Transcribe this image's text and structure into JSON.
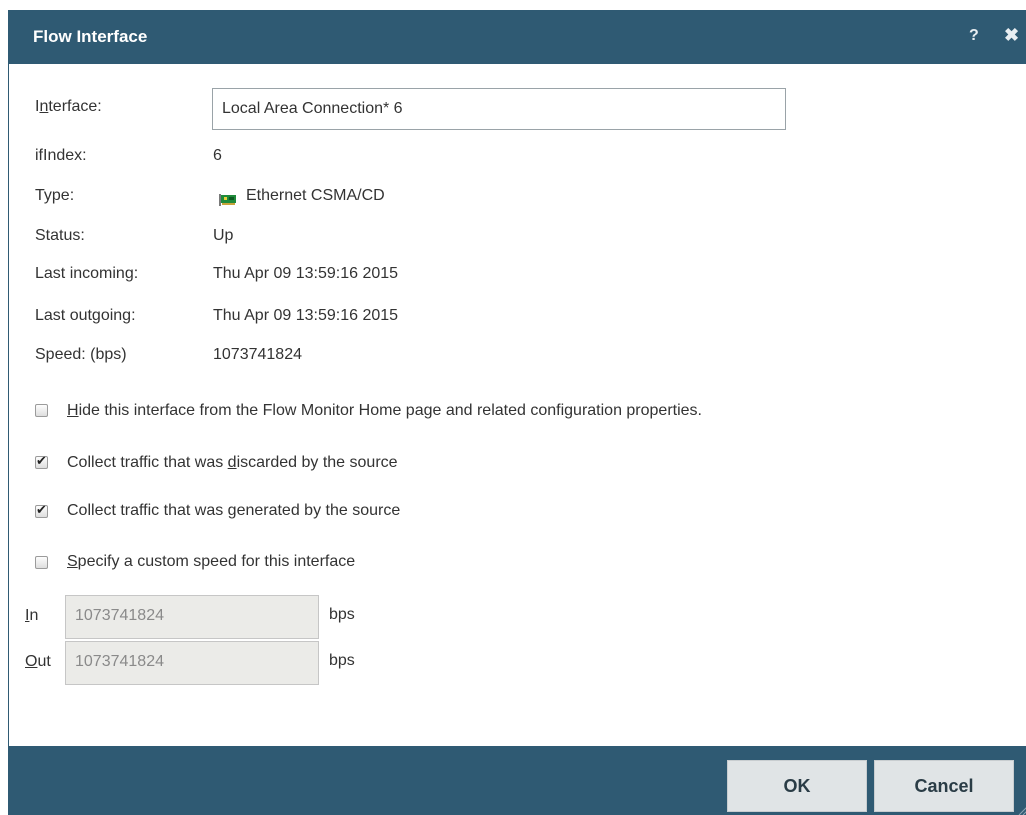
{
  "dialog": {
    "title": "Flow Interface",
    "help_glyph": "?",
    "close_glyph": "✖"
  },
  "fields": {
    "interface_label_pre": "I",
    "interface_label_u": "n",
    "interface_label_post": "terface:",
    "interface_value": "Local Area Connection* 6",
    "ifindex_label": "ifIndex:",
    "ifindex_value": "6",
    "type_label": "Type:",
    "type_value": "Ethernet CSMA/CD",
    "type_icon": "network-card-icon",
    "status_label": "Status:",
    "status_value": "Up",
    "last_incoming_label": "Last incoming:",
    "last_incoming_value": "Thu Apr 09 13:59:16 2015",
    "last_outgoing_label": "Last outgoing:",
    "last_outgoing_value": "Thu Apr 09 13:59:16 2015",
    "speed_label": "Speed: (bps)",
    "speed_value": "1073741824"
  },
  "options": {
    "hide_u": "H",
    "hide_rest": "ide this interface from the Flow Monitor Home page and related configuration properties.",
    "hide_checked": false,
    "discarded_pre": "Collect traffic that was ",
    "discarded_u": "d",
    "discarded_post": "iscarded by the source",
    "discarded_checked": true,
    "generated_pre": "Collect traffic that was ",
    "generated_u": "g",
    "generated_post": "enerated by the source",
    "generated_checked": true,
    "custom_u": "S",
    "custom_rest": "pecify a custom speed for this interface",
    "custom_checked": false
  },
  "custom_speed": {
    "in_label_u": "I",
    "in_label_rest": "n",
    "in_value": "1073741824",
    "out_label_u": "O",
    "out_label_rest": "ut",
    "out_value": "1073741824",
    "unit": "bps"
  },
  "buttons": {
    "ok": "OK",
    "cancel": "Cancel"
  },
  "colors": {
    "titlebar": "#2f5a73",
    "button_bg": "#e0e4e6",
    "disabled_input": "#ebebe8"
  }
}
